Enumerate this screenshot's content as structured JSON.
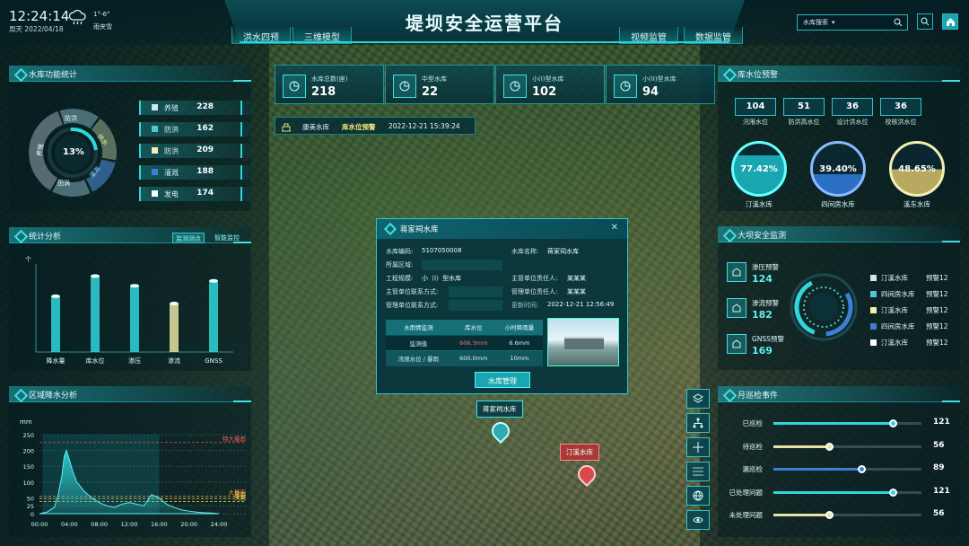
{
  "header": {
    "time": "12:24:14",
    "date": "周天 2022/04/18",
    "temp": "1°-6°",
    "weather": "雨夹雪",
    "title": "堤坝安全运营平台",
    "nav_left": [
      "洪水四预",
      "三维模型"
    ],
    "nav_right": [
      "视频监管",
      "数据监管"
    ],
    "search_label": "水库搜索"
  },
  "func_stats": {
    "title": "水库功能统计",
    "center_pct": "13%",
    "ring_labels": [
      "防洪",
      "供水",
      "灌溉",
      "田涡",
      "养殖"
    ],
    "items": [
      {
        "label": "养殖",
        "value": "228",
        "color": "#cfe7f3"
      },
      {
        "label": "防洪",
        "value": "162",
        "color": "#4fc7d9"
      },
      {
        "label": "防洪",
        "value": "209",
        "color": "#f3efb4"
      },
      {
        "label": "灌溉",
        "value": "188",
        "color": "#3e7fd6"
      },
      {
        "label": "发电",
        "value": "174",
        "color": "#ffffff"
      }
    ]
  },
  "analysis": {
    "title": "统计分析",
    "tabs": [
      "监测测点",
      "智能监控"
    ],
    "y_arrow": "个"
  },
  "rain": {
    "title": "区域降水分析",
    "unit": "mm",
    "levels": [
      "特大暴雨",
      "大暴雨",
      "暴雨",
      "大雨"
    ]
  },
  "chart_data": [
    {
      "type": "bar",
      "title": "统计分析",
      "categories": [
        "降水量",
        "库水位",
        "渗压",
        "渗流",
        "GNSS"
      ],
      "values": [
        345,
        470,
        410,
        300,
        440
      ],
      "colors": [
        "#2fd6dc",
        "#2fd6dc",
        "#2fd6dc",
        "#e7e3a5",
        "#2fd6dc"
      ],
      "ylim": [
        0,
        500
      ]
    },
    {
      "type": "area",
      "title": "区域降水分析",
      "ylabel": "mm",
      "x_ticks": [
        "00:00",
        "04:00",
        "08:00",
        "12:00",
        "16:00",
        "20:00",
        "24:00"
      ],
      "y_ticks": [
        0,
        25,
        50,
        100,
        150,
        200,
        250
      ],
      "ylim": [
        0,
        250
      ],
      "x": [
        0,
        1,
        2,
        2.5,
        3,
        3.3,
        3.6,
        4,
        4.5,
        5,
        6,
        7,
        8,
        9,
        10,
        11,
        12,
        13,
        14,
        15,
        16,
        17,
        18,
        19,
        20,
        21,
        22,
        23,
        24
      ],
      "y": [
        0,
        5,
        20,
        60,
        120,
        180,
        200,
        170,
        130,
        100,
        70,
        50,
        35,
        25,
        20,
        30,
        35,
        30,
        25,
        60,
        50,
        30,
        20,
        12,
        8,
        5,
        3,
        2,
        0
      ]
    }
  ],
  "cards": [
    {
      "label": "水库总数(座)",
      "value": "218"
    },
    {
      "label": "中型水库",
      "value": "22"
    },
    {
      "label": "小(I)型水库",
      "value": "102"
    },
    {
      "label": "小(II)型水库",
      "value": "94"
    }
  ],
  "alert": {
    "name": "康美水库",
    "tag": "库水位预警",
    "time": "2022-12-21 15:39:24"
  },
  "popup": {
    "title": "蒋家祠水库",
    "code_label": "水库编码:",
    "code": "5107050008",
    "name_label": "水库名称:",
    "name": "蒋家祠水库",
    "area_label": "所属区域:",
    "scale_label": "工程规模:",
    "scale": "小（I）型水库",
    "resp_label": "主管单位责任人:",
    "resp": "某某某",
    "contact_label": "主管单位联系方式:",
    "mgr_label": "管理单位责任人:",
    "mgr": "某某某",
    "mgr_contact_label": "管理单位联系方式:",
    "update_label": "更新时间:",
    "update": "2022-12-21 12:56:49",
    "table": {
      "head": [
        "水雨情监测",
        "库水位",
        "小时降雨量"
      ],
      "row1": [
        "监测值",
        "606.3mm",
        "6.6mm"
      ],
      "row2": [
        "汛限水位 / 暴雨",
        "600.0mm",
        "10mm"
      ]
    },
    "button": "水库管理"
  },
  "markers": [
    {
      "label": "蒋家祠水库"
    },
    {
      "label": "汀溪水库"
    }
  ],
  "water_warn": {
    "title": "库水位预警",
    "boxes": [
      {
        "value": "104",
        "label": "汛限水位"
      },
      {
        "value": "51",
        "label": "防洪高水位"
      },
      {
        "value": "36",
        "label": "设计洪水位"
      },
      {
        "value": "36",
        "label": "校核洪水位"
      }
    ],
    "balls": [
      {
        "value": "77.42%",
        "label": "汀溪水库",
        "fill": 0.7742
      },
      {
        "value": "39.40%",
        "label": "四间房水库",
        "fill": 0.394
      },
      {
        "value": "48.65%",
        "label": "溪东水库",
        "fill": 0.4865
      }
    ]
  },
  "dam": {
    "title": "大坝安全监测",
    "items": [
      {
        "label": "渗压预警",
        "value": "124"
      },
      {
        "label": "渗流预警",
        "value": "182"
      },
      {
        "label": "GNSS预警",
        "value": "169"
      }
    ],
    "list": [
      {
        "name": "汀溪水库",
        "warn": "预警12",
        "color": "#cfe7f3"
      },
      {
        "name": "四间房水库",
        "warn": "预警12",
        "color": "#4fc7d9"
      },
      {
        "name": "汀溪水库",
        "warn": "预警12",
        "color": "#f3efb4"
      },
      {
        "name": "四间房水库",
        "warn": "预警12",
        "color": "#3e7fd6"
      },
      {
        "name": "汀溪水库",
        "warn": "预警12",
        "color": "#ffffff"
      }
    ]
  },
  "patrol": {
    "title": "月巡检事件",
    "max": 150,
    "items": [
      {
        "label": "已巡检",
        "value": 121,
        "color": "#2fd6dc"
      },
      {
        "label": "待巡检",
        "value": 56,
        "color": "#e7e3a5"
      },
      {
        "label": "漏巡检",
        "value": 89,
        "color": "#3e7fd6"
      },
      {
        "label": "已处理问题",
        "value": 121,
        "color": "#2fd6dc"
      },
      {
        "label": "未处理问题",
        "value": 56,
        "color": "#e7e3a5"
      }
    ]
  }
}
